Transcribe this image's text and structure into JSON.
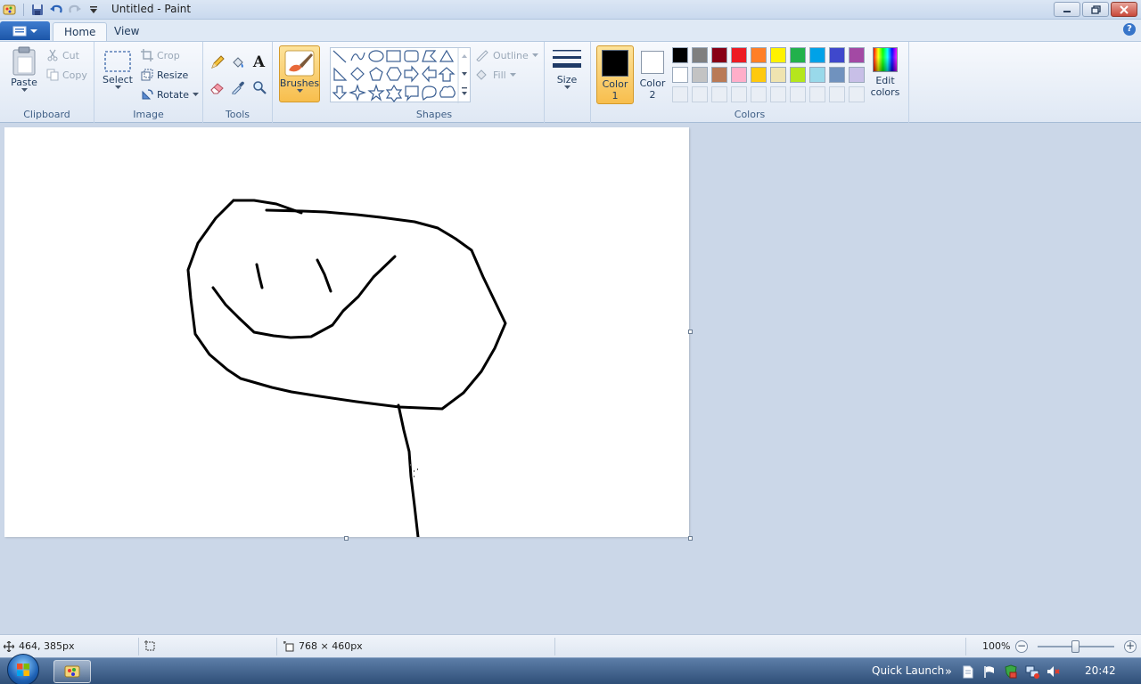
{
  "window": {
    "title": "Untitled - Paint"
  },
  "tabs": [
    {
      "label": "Home"
    },
    {
      "label": "View"
    }
  ],
  "help_label": "?",
  "ribbon": {
    "clipboard": {
      "label": "Clipboard",
      "paste": "Paste",
      "cut": "Cut",
      "copy": "Copy"
    },
    "image": {
      "label": "Image",
      "select": "Select",
      "crop": "Crop",
      "resize": "Resize",
      "rotate": "Rotate"
    },
    "tools": {
      "label": "Tools",
      "text_glyph": "A"
    },
    "brushes": {
      "label": "Brushes"
    },
    "shapes": {
      "label": "Shapes",
      "outline": "Outline",
      "fill": "Fill"
    },
    "size": {
      "label": "Size"
    },
    "colors": {
      "label": "Colors",
      "color1_line1": "Color",
      "color1_line2": "1",
      "color2_line1": "Color",
      "color2_line2": "2",
      "edit_line1": "Edit",
      "edit_line2": "colors",
      "color1_value": "#000000",
      "color2_value": "#ffffff",
      "palette_row1": [
        "#000000",
        "#7f7f7f",
        "#880015",
        "#ed1c24",
        "#ff7f27",
        "#fff200",
        "#22b14c",
        "#00a2e8",
        "#3f48cc",
        "#a349a4"
      ],
      "palette_row2": [
        "#ffffff",
        "#c3c3c3",
        "#b97a57",
        "#ffaec9",
        "#ffc90e",
        "#efe4b0",
        "#b5e61d",
        "#99d9ea",
        "#7092be",
        "#c8bfe7"
      ]
    }
  },
  "statusbar": {
    "cursor_pos": "464, 385px",
    "canvas_size": "768 × 460px",
    "zoom": "100%",
    "zoom_minus": "−",
    "zoom_plus": "+"
  },
  "taskbar": {
    "quick_launch": "Quick Launch",
    "quick_launch_arrow": "»",
    "clock": "20:42"
  }
}
